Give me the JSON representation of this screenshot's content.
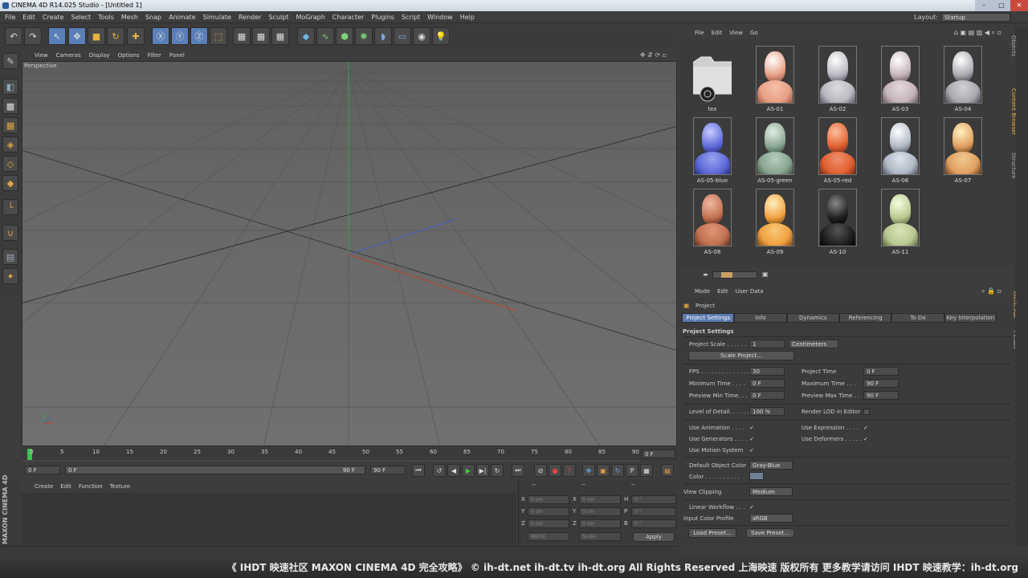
{
  "window": {
    "title": "CINEMA 4D R14.025 Studio - [Untitled 1]",
    "layout_label": "Layout:",
    "layout_value": "Startup"
  },
  "menu": [
    "File",
    "Edit",
    "Create",
    "Select",
    "Tools",
    "Mesh",
    "Snap",
    "Animate",
    "Simulate",
    "Render",
    "Sculpt",
    "MoGraph",
    "Character",
    "Plugins",
    "Script",
    "Window",
    "Help"
  ],
  "viewport": {
    "menu": [
      "View",
      "Cameras",
      "Display",
      "Options",
      "Filter",
      "Panel"
    ],
    "label": "Perspective"
  },
  "timeline": {
    "ticks": [
      "0",
      "5",
      "10",
      "15",
      "20",
      "25",
      "30",
      "35",
      "40",
      "45",
      "50",
      "55",
      "60",
      "65",
      "70",
      "75",
      "80",
      "85",
      "90"
    ],
    "frame_field": "0 F",
    "start": "0 F",
    "range_start": "0 F",
    "range_end": "90 F",
    "end": "90 F"
  },
  "materials": {
    "menu": [
      "Create",
      "Edit",
      "Function",
      "Texture"
    ]
  },
  "coords": {
    "labels": [
      "X",
      "Y",
      "Z"
    ],
    "pos": [
      "0 cm",
      "0 cm",
      "0 cm"
    ],
    "size_labels": [
      "X",
      "Y",
      "Z"
    ],
    "size": [
      "0 cm",
      "0 cm",
      "0 cm"
    ],
    "rot_labels": [
      "H",
      "P",
      "B"
    ],
    "rot": [
      "0 °",
      "0 °",
      "0 °"
    ],
    "world": "World",
    "scale": "Scale",
    "apply": "Apply",
    "dash": "--"
  },
  "maxon": {
    "text": "MAXON CINEMA 4D"
  },
  "content_browser": {
    "menu": [
      "File",
      "Edit",
      "View",
      "Go"
    ],
    "items": [
      {
        "label": "tex",
        "color": "#d9d9d9",
        "kind": "folder"
      },
      {
        "label": "AS-01",
        "color": "#e8a085"
      },
      {
        "label": "AS-02",
        "color": "#b8b8c0"
      },
      {
        "label": "AS-03",
        "color": "#c4b4b8"
      },
      {
        "label": "AS-04",
        "color": "#a9a9b0"
      },
      {
        "label": "AS-05-blue",
        "color": "#5e6ad8"
      },
      {
        "label": "AS-05-green",
        "color": "#8aa592"
      },
      {
        "label": "AS-05-red",
        "color": "#e06030"
      },
      {
        "label": "AS-06",
        "color": "#b0b8c4"
      },
      {
        "label": "AS-07",
        "color": "#e0a060"
      },
      {
        "label": "AS-08",
        "color": "#c07050"
      },
      {
        "label": "AS-09",
        "color": "#f0a040"
      },
      {
        "label": "AS-10",
        "color": "#202020"
      },
      {
        "label": "AS-11",
        "color": "#b8c890"
      }
    ]
  },
  "sidetabs": [
    "Objects",
    "Content Browser",
    "Structure",
    "Attributes",
    "Layers"
  ],
  "attributes": {
    "menu": [
      "Mode",
      "Edit",
      "User Data"
    ],
    "object": "Project",
    "tabs": [
      "Project Settings",
      "Info",
      "Dynamics",
      "Referencing",
      "To Do",
      "Key Interpolation"
    ],
    "section": "Project Settings",
    "project_scale_label": "Project Scale . . . . . .",
    "project_scale": "1",
    "units": "Centimeters",
    "scale_project": "Scale Project...",
    "fps_label": "FPS . . . . . . . . . . . . . .",
    "fps": "30",
    "project_time_label": "Project Time",
    "project_time": "0 F",
    "min_time_label": "Minimum Time . . . .",
    "min_time": "0 F",
    "max_time_label": "Maximum Time . . .",
    "max_time": "90 F",
    "prev_min_label": "Preview Min Time. . .",
    "prev_min": "0 F",
    "prev_max_label": "Preview Max Time . .",
    "prev_max": "90 F",
    "lod_label": "Level of Detail. . . . . .",
    "lod": "100 %",
    "render_lod_label": "Render LOD in Editor",
    "use_animation": "Use Animation . . . .",
    "use_expression": "Use Expression . . . .",
    "use_generators": "Use Generators . . . .",
    "use_deformers": "Use Deformers . . . . .",
    "use_motion": "Use Motion System",
    "default_color_label": "Default Object Color",
    "default_color": "Gray-Blue",
    "color_label": "Color . . . . . . . . . .",
    "view_clipping_label": "View Clipping",
    "view_clipping": "Medium",
    "linear_workflow_label": "Linear Workflow . . .",
    "input_color_label": "Input Color Profile",
    "input_color": "sRGB",
    "load_preset": "Load Preset...",
    "save_preset": "Save Preset...",
    "check": "✓"
  },
  "watermark": "《 IHDT 映速社区 MAXON CINEMA 4D 完全攻略》 © ih-dt.net ih-dt.tv ih-dt.org All Rights Reserved 上海映速 版权所有 更多教学请访问 IHDT 映速教学：ih-dt.org"
}
